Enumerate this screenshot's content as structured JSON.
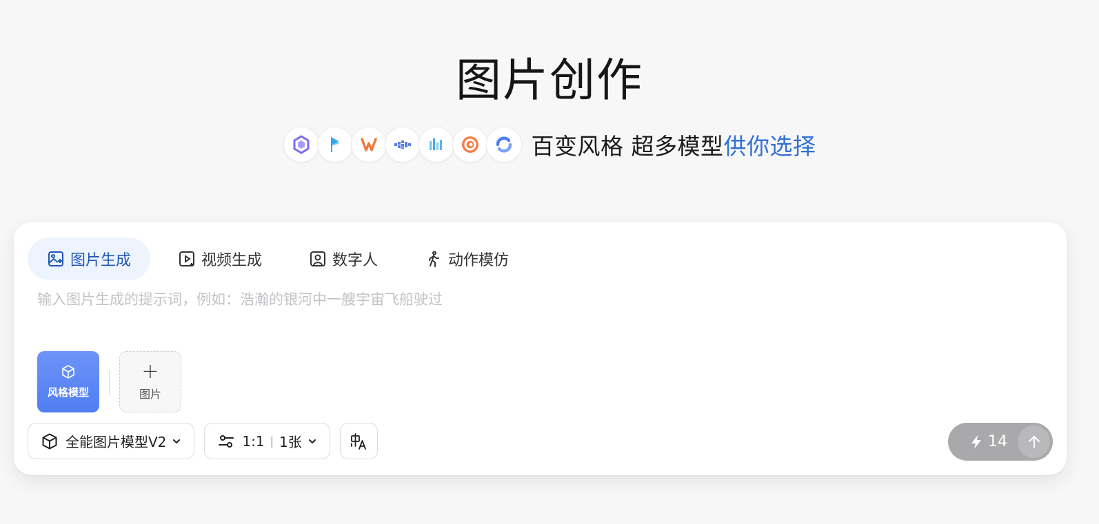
{
  "hero": {
    "title": "图片创作",
    "slogan_main": "百变风格 超多模型",
    "slogan_accent": "供你选择",
    "logos": [
      "qwen-logo",
      "kling-logo",
      "vidu-logo",
      "pixverse-logo",
      "doubao-logo",
      "hailuo-logo",
      "spark-logo"
    ]
  },
  "tabs": [
    {
      "label": "图片生成",
      "icon": "image-gen-icon",
      "active": true
    },
    {
      "label": "视频生成",
      "icon": "video-gen-icon",
      "active": false
    },
    {
      "label": "数字人",
      "icon": "digital-human-icon",
      "active": false
    },
    {
      "label": "动作模仿",
      "icon": "motion-mimic-icon",
      "active": false
    }
  ],
  "prompt": {
    "value": "",
    "placeholder": "输入图片生成的提示词，例如：浩瀚的银河中一艘宇宙飞船驶过"
  },
  "attach": {
    "style_model_label": "风格模型",
    "add_image_label": "图片"
  },
  "controls": {
    "model_label": "全能图片模型V2",
    "ratio": "1:1",
    "count": "1张"
  },
  "send": {
    "cost": "14"
  },
  "colors": {
    "accent": "#2f6fd6",
    "active_tab_bg": "#eef4fd",
    "style_btn": "#5a88f5",
    "send_bg": "#a9a9ab"
  }
}
